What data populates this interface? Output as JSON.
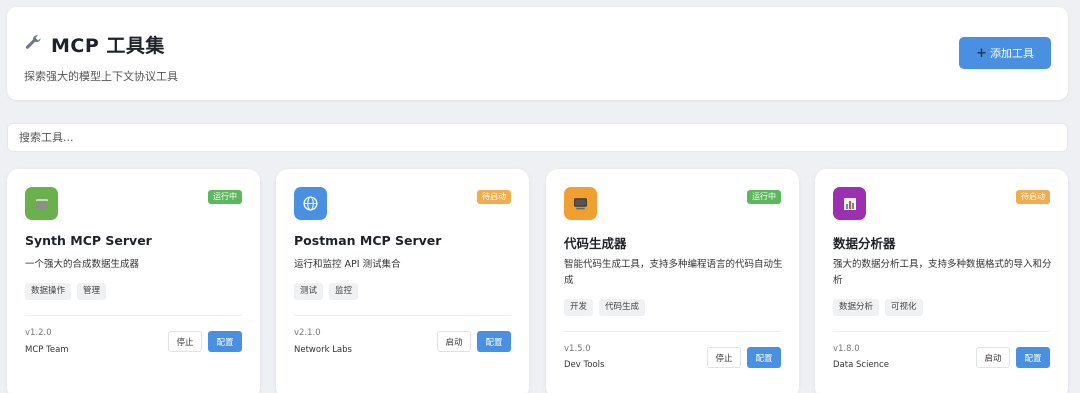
{
  "header": {
    "title": "MCP 工具集",
    "subtitle": "探索强大的模型上下文协议工具",
    "add_label": "添加工具",
    "wrench_icon": "wrench-icon"
  },
  "search": {
    "placeholder": "搜索工具...",
    "value": ""
  },
  "colors": {
    "accent": "#4a90e2",
    "running": "#5cb85c",
    "pending": "#f0ad4e"
  },
  "cards": [
    {
      "name": "Synth MCP Server",
      "status": "运行中",
      "status_kind": "running",
      "icon": "folder-icon",
      "icon_bg": "#6ab04c",
      "description": "一个强大的合成数据生成器",
      "tags": [
        "数据操作",
        "管理"
      ],
      "version": "v1.2.0",
      "author": "MCP Team",
      "action_label": "停止",
      "config_label": "配置"
    },
    {
      "name": "Postman MCP Server",
      "status": "待启动",
      "status_kind": "pending",
      "icon": "globe-icon",
      "icon_bg": "#4a90e2",
      "description": "运行和监控 API 测试集合",
      "tags": [
        "测试",
        "监控"
      ],
      "version": "v2.1.0",
      "author": "Network Labs",
      "action_label": "启动",
      "config_label": "配置"
    },
    {
      "name": "代码生成器",
      "status": "运行中",
      "status_kind": "running",
      "icon": "computer-icon",
      "icon_bg": "#f0a030",
      "description": "智能代码生成工具，支持多种编程语言的代码自动生成",
      "tags": [
        "开发",
        "代码生成"
      ],
      "version": "v1.5.0",
      "author": "Dev Tools",
      "action_label": "停止",
      "config_label": "配置"
    },
    {
      "name": "数据分析器",
      "status": "待启动",
      "status_kind": "pending",
      "icon": "bar-chart-icon",
      "icon_bg": "#9b30b0",
      "description": "强大的数据分析工具，支持多种数据格式的导入和分析",
      "tags": [
        "数据分析",
        "可视化"
      ],
      "version": "v1.8.0",
      "author": "Data Science",
      "action_label": "启动",
      "config_label": "配置"
    }
  ]
}
